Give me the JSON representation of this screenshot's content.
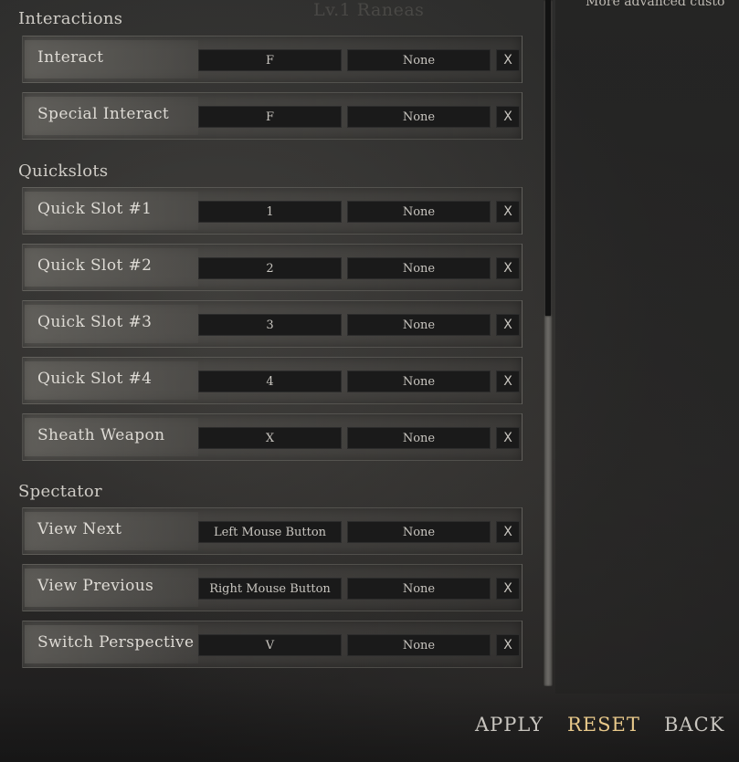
{
  "background": {
    "ghost_title": "Lv.1 Raneas",
    "right_description": "More advanced custo"
  },
  "sections": {
    "interactions": {
      "title": "Interactions",
      "rows": [
        {
          "label": "Interact",
          "primary": "F",
          "secondary": "None",
          "clear": "X"
        },
        {
          "label": "Special Interact",
          "primary": "F",
          "secondary": "None",
          "clear": "X"
        }
      ]
    },
    "quickslots": {
      "title": "Quickslots",
      "rows": [
        {
          "label": "Quick Slot #1",
          "primary": "1",
          "secondary": "None",
          "clear": "X"
        },
        {
          "label": "Quick Slot #2",
          "primary": "2",
          "secondary": "None",
          "clear": "X"
        },
        {
          "label": "Quick Slot #3",
          "primary": "3",
          "secondary": "None",
          "clear": "X"
        },
        {
          "label": "Quick Slot #4",
          "primary": "4",
          "secondary": "None",
          "clear": "X"
        },
        {
          "label": "Sheath Weapon",
          "primary": "X",
          "secondary": "None",
          "clear": "X"
        }
      ]
    },
    "spectator": {
      "title": "Spectator",
      "rows": [
        {
          "label": "View Next",
          "primary": "Left Mouse Button",
          "secondary": "None",
          "clear": "X"
        },
        {
          "label": "View Previous",
          "primary": "Right Mouse Button",
          "secondary": "None",
          "clear": "X"
        },
        {
          "label": "Switch Perspective",
          "primary": "V",
          "secondary": "None",
          "clear": "X"
        }
      ]
    }
  },
  "footer": {
    "apply": "APPLY",
    "reset": "RESET",
    "back": "BACK"
  },
  "colors": {
    "accent_reset": "#e8c98a",
    "key_box_bg": "#1a1a1a",
    "text_primary": "#dedbd5"
  }
}
